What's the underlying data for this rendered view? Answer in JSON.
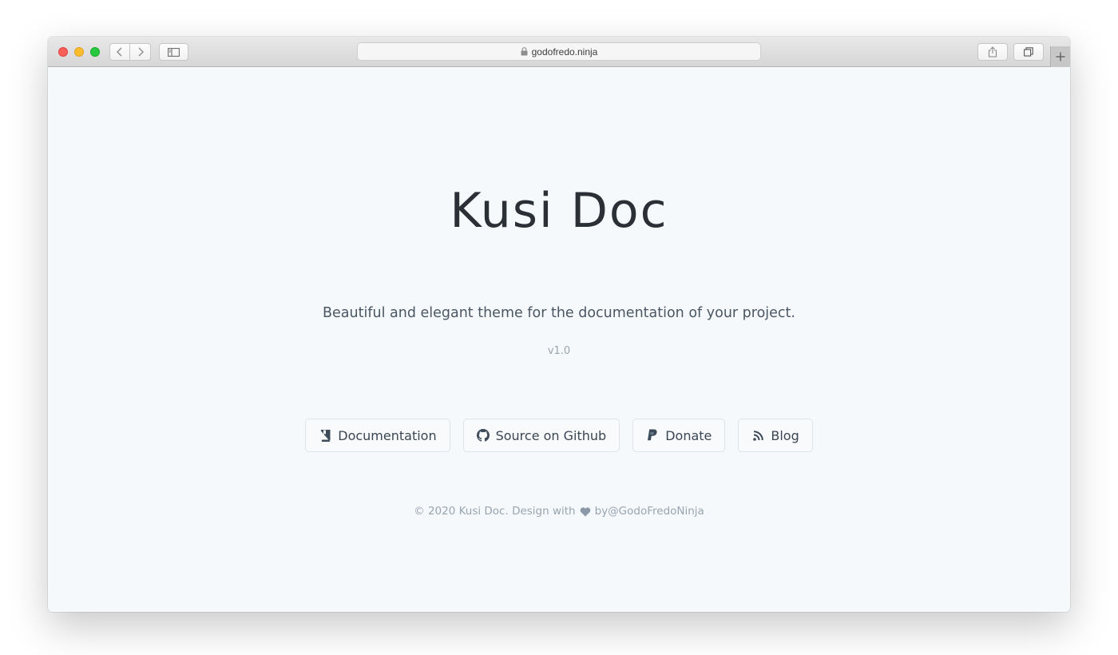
{
  "browser": {
    "url": "godofredo.ninja"
  },
  "hero": {
    "title": "Kusi Doc",
    "subtitle": "Beautiful and elegant theme for the documentation of your project.",
    "version": "v1.0"
  },
  "buttons": [
    {
      "label": "Documentation",
      "icon": "book-icon"
    },
    {
      "label": "Source on Github",
      "icon": "github-icon"
    },
    {
      "label": "Donate",
      "icon": "paypal-icon"
    },
    {
      "label": "Blog",
      "icon": "rss-icon"
    }
  ],
  "footer": {
    "prefix": "© 2020 Kusi Doc. Design with",
    "suffix": "by@GodoFredoNinja"
  },
  "colors": {
    "background": "#f6f9fb",
    "title": "#2b3036",
    "muted": "#98a4b0"
  }
}
